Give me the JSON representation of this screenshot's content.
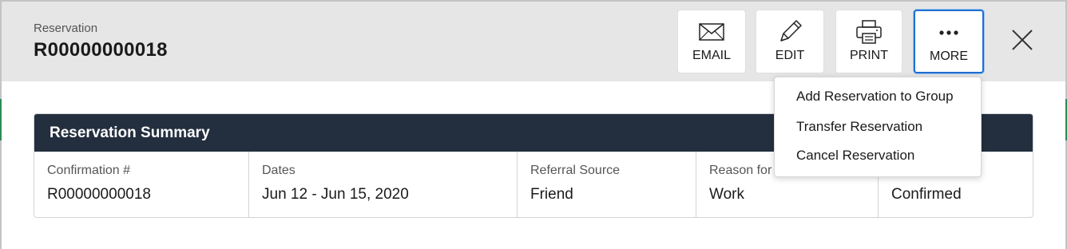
{
  "header": {
    "eyebrow": "Reservation",
    "reservation_id": "R00000000018"
  },
  "actions": {
    "email_label": "EMAIL",
    "edit_label": "EDIT",
    "print_label": "PRINT",
    "more_label": "MORE"
  },
  "summary": {
    "title": "Reservation Summary",
    "fields": [
      {
        "label": "Confirmation #",
        "value": "R00000000018"
      },
      {
        "label": "Dates",
        "value": "Jun 12 - Jun 15, 2020"
      },
      {
        "label": "Referral Source",
        "value": "Friend"
      },
      {
        "label": "Reason for",
        "value": "Work"
      },
      {
        "label": "",
        "value": "Confirmed"
      }
    ]
  },
  "more_menu": {
    "items": [
      {
        "label": "Add Reservation to Group"
      },
      {
        "label": "Transfer Reservation"
      },
      {
        "label": "Cancel Reservation"
      }
    ]
  },
  "icons": {
    "email": "envelope-icon",
    "edit": "pencil-icon",
    "print": "printer-icon",
    "more": "ellipsis-icon",
    "close": "close-icon"
  },
  "colors": {
    "header_bg": "#e6e6e6",
    "summary_header_bg": "#232f3e",
    "focus_blue": "#1f6fd1"
  }
}
